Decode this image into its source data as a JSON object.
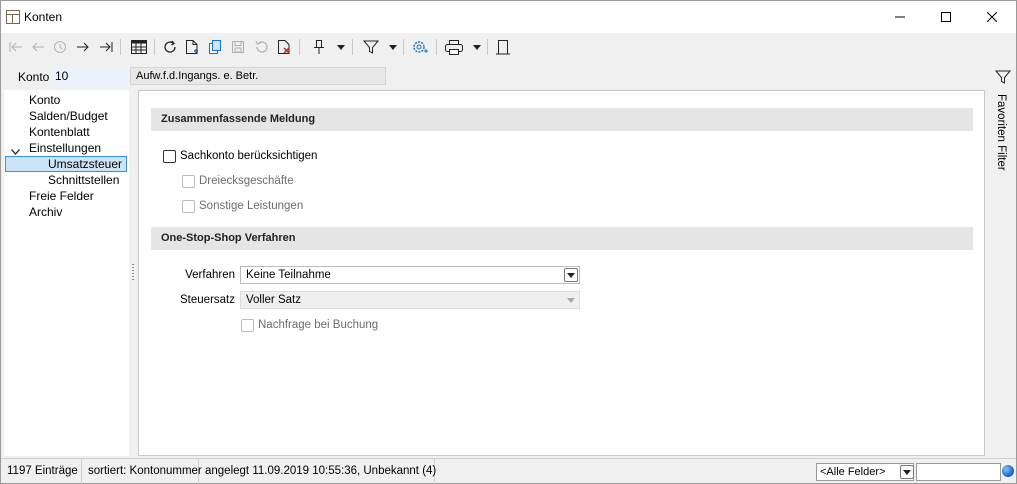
{
  "window": {
    "title": "Konten"
  },
  "toolbar": {
    "icons": [
      "first-record-icon",
      "previous-record-icon",
      "history-icon",
      "next-record-icon",
      "last-record-icon",
      "table-view-icon",
      "refresh-icon",
      "new-document-icon",
      "copy-icon",
      "save-icon",
      "undo-icon",
      "delete-icon",
      "pin-icon",
      "filter-icon",
      "settings-icon",
      "print-icon",
      "bookmark-icon"
    ]
  },
  "konto": {
    "label": "Konto",
    "value": "10",
    "description": "Aufw.f.d.Ingangs. e. Betr."
  },
  "nav": {
    "items": [
      {
        "label": "Konto"
      },
      {
        "label": "Salden/Budget"
      },
      {
        "label": "Kontenblatt"
      },
      {
        "label": "Einstellungen"
      },
      {
        "label": "Umsatzsteuer"
      },
      {
        "label": "Schnittstellen"
      },
      {
        "label": "Freie Felder"
      },
      {
        "label": "Archiv"
      }
    ]
  },
  "zm": {
    "header": "Zusammenfassende Meldung",
    "sachkonto_label": "Sachkonto berücksichtigen",
    "dreiecks_label": "Dreiecksgeschäfte",
    "sonstige_label": "Sonstige Leistungen"
  },
  "oss": {
    "header": "One-Stop-Shop Verfahren",
    "verfahren_label": "Verfahren",
    "verfahren_value": "Keine Teilnahme",
    "steuersatz_label": "Steuersatz",
    "steuersatz_value": "Voller Satz",
    "nachfrage_label": "Nachfrage bei Buchung"
  },
  "sidebar": {
    "favoriten_label": "Favoriten Filter"
  },
  "status": {
    "entries": "1197 Einträge",
    "sorted": "sortiert: Kontonummer",
    "created": "angelegt 11.09.2019 10:55:36, Unbekannt (4)",
    "field_select": "<Alle Felder>",
    "search_value": ""
  },
  "colors": {
    "selection_bg": "#cce4f7",
    "selection_border": "#3c8fd6",
    "section_header_bg": "#e5e5e5",
    "icon_accent": "#1a73c8"
  }
}
